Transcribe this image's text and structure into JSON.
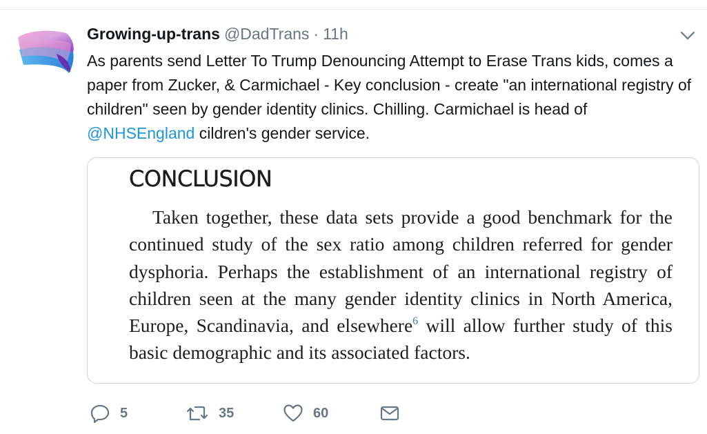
{
  "tweet": {
    "display_name": "Growing-up-trans",
    "handle": "@DadTrans",
    "separator": "·",
    "time": "11h",
    "text_before_mention": "As parents send Letter To Trump Denouncing Attempt to Erase Trans kids, comes a paper from Zucker, & Carmichael - Key conclusion - create \"an international registry of children\" seen by gender identity clinics. Chilling. Carmichael is head of ",
    "mention": "@NHSEngland",
    "text_after_mention": " cildren's gender service."
  },
  "card": {
    "heading": "CONCLUSION",
    "body_before_sup": "Taken together, these data sets provide a good benchmark for the continued study of the sex ratio among children referred for gender dysphoria. Perhaps the establishment of an international registry of children seen at the many gender identity clinics in North America, Europe, Scandinavia, and elsewhere",
    "superscript": "6",
    "body_after_sup": " will allow further study of this basic demographic and its associated factors."
  },
  "actions": {
    "reply_count": "5",
    "retweet_count": "35",
    "like_count": "60"
  },
  "icons": {
    "reply": "reply-icon",
    "retweet": "retweet-icon",
    "like": "heart-icon",
    "dm": "envelope-icon",
    "caret": "chevron-down-icon"
  },
  "colors": {
    "link": "#1b95e0",
    "secondary_text": "#657786",
    "primary_text": "#14171a",
    "border": "#ccd6dd"
  }
}
